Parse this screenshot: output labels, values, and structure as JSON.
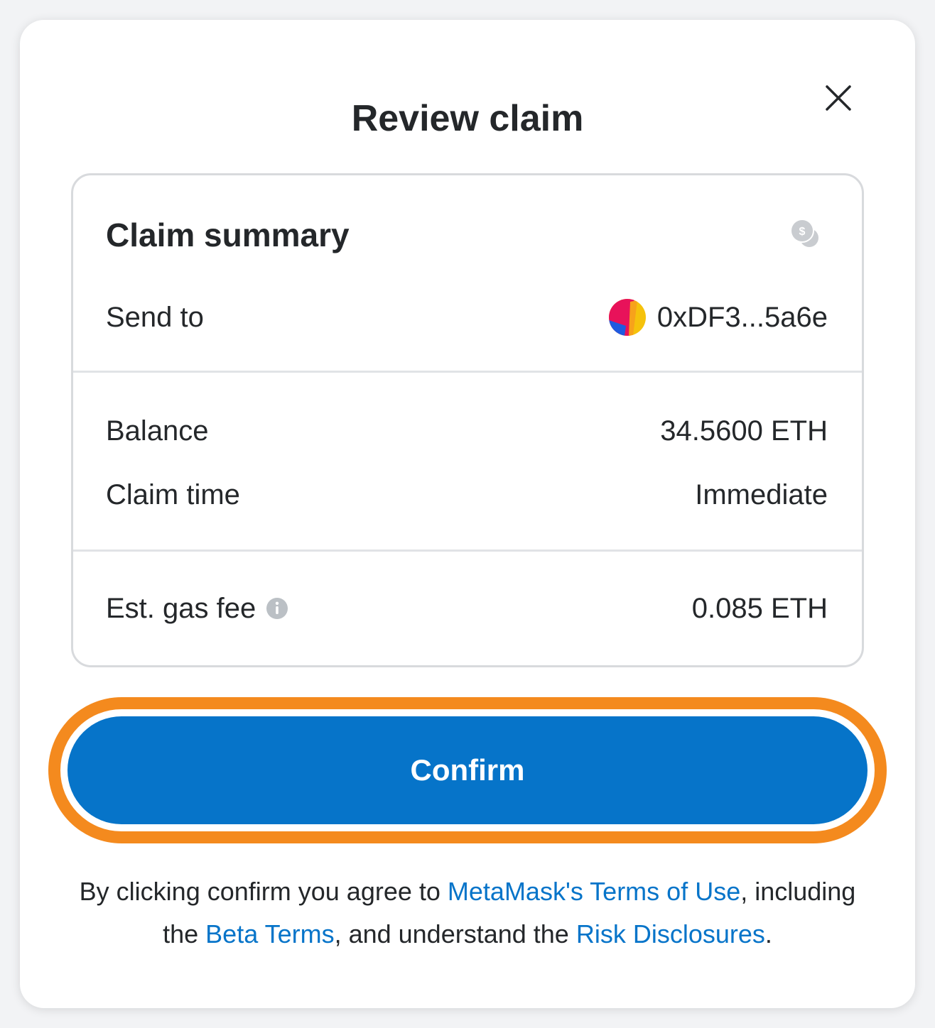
{
  "header": {
    "title": "Review claim",
    "close_icon": "close-icon"
  },
  "summary": {
    "title": "Claim summary",
    "coin_icon": "coins-icon",
    "send_to": {
      "label": "Send to",
      "address": "0xDF3...5a6e"
    },
    "balance": {
      "label": "Balance",
      "value": "34.5600 ETH"
    },
    "claim_time": {
      "label": "Claim time",
      "value": "Immediate"
    },
    "gas_fee": {
      "label": "Est. gas fee",
      "value": "0.085 ETH",
      "info_icon": "info-icon"
    }
  },
  "confirm": {
    "label": "Confirm"
  },
  "disclaimer": {
    "part1": "By clicking confirm you agree to ",
    "link1": "MetaMask's Terms of Use",
    "part2": ", including the ",
    "link2": "Beta Terms",
    "part3": ", and understand the ",
    "link3": "Risk Disclosures",
    "part4": "."
  },
  "colors": {
    "accent_blue": "#0674c9",
    "highlight_orange": "#f48a1e",
    "text": "#24272a",
    "border": "#d8dadd"
  }
}
